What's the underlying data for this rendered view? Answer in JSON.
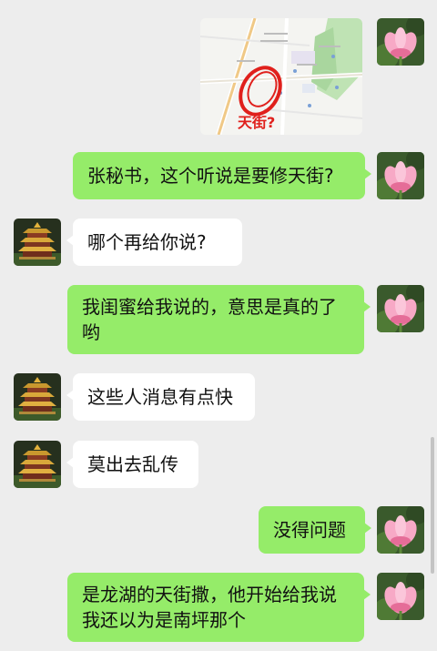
{
  "messages": [
    {
      "side": "out",
      "type": "image",
      "map_label": "天街?"
    },
    {
      "side": "out",
      "text": "张秘书，这个听说是要修天街?"
    },
    {
      "side": "in",
      "text": "哪个再给你说?"
    },
    {
      "side": "out",
      "text": "我闺蜜给我说的，意思是真的了哟"
    },
    {
      "side": "in",
      "text": "这些人消息有点快"
    },
    {
      "side": "in",
      "text": "莫出去乱传"
    },
    {
      "side": "out",
      "text": "没得问题"
    },
    {
      "side": "out",
      "text": "是龙湖的天街撒，他开始给我说我还以为是南坪那个"
    }
  ],
  "colors": {
    "background": "#ededed",
    "outgoing_bubble": "#95ec69",
    "incoming_bubble": "#ffffff",
    "map_annotation": "#e0201c"
  },
  "icons": {
    "self_avatar": "lotus-flower-icon",
    "contact_avatar": "pavilion-tower-icon"
  }
}
